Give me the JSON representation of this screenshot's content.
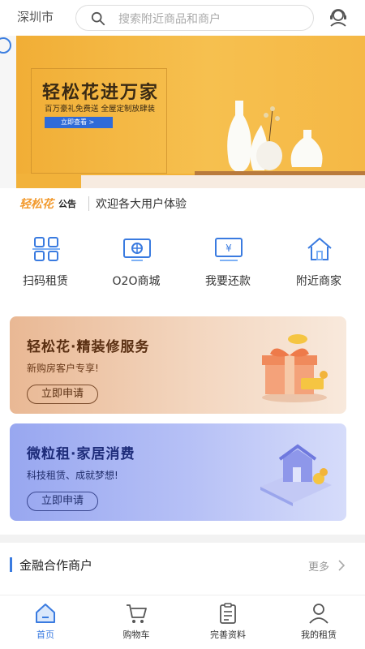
{
  "header": {
    "city": "深圳市",
    "search_placeholder": "搜索附近商品和商户",
    "icons": {
      "search": "search-icon",
      "profile": "user-service-icon"
    }
  },
  "banner": {
    "title": "轻松花进万家",
    "subtitle": "百万豪礼免费送  全屋定制放肆装",
    "cta": "立即查看 >",
    "slides": 3,
    "active_slide": 1
  },
  "notice": {
    "brand": "轻松花",
    "tag": "公告",
    "message": "欢迎各大用户体验"
  },
  "menu": [
    {
      "label": "扫码租赁",
      "icon": "scan-icon"
    },
    {
      "label": "O2O商城",
      "icon": "o2o-mall-icon"
    },
    {
      "label": "我要还款",
      "icon": "repay-icon"
    },
    {
      "label": "附近商家",
      "icon": "nearby-store-icon"
    }
  ],
  "cards": [
    {
      "title": "轻松花·精装修服务",
      "subtitle": "新购房客户专享!",
      "button": "立即申请",
      "art": "gift-box-icon"
    },
    {
      "title": "微粒租·家居消费",
      "subtitle": "科技租赁、成就梦想!",
      "button": "立即申请",
      "art": "home-phone-icon"
    }
  ],
  "partners": {
    "title": "金融合作商户",
    "more": "更多"
  },
  "tabbar": [
    {
      "label": "首页",
      "icon": "home-icon",
      "active": true
    },
    {
      "label": "购物车",
      "icon": "cart-icon",
      "active": false
    },
    {
      "label": "完善资料",
      "icon": "clipboard-icon",
      "active": false
    },
    {
      "label": "我的租赁",
      "icon": "profile-icon",
      "active": false
    }
  ],
  "colors": {
    "accent": "#3a7be0",
    "brand_orange": "#f29a2e",
    "banner_bg": "#f2b23a",
    "card1_bg": "#e9b894",
    "card2_bg": "#98a7f0"
  }
}
